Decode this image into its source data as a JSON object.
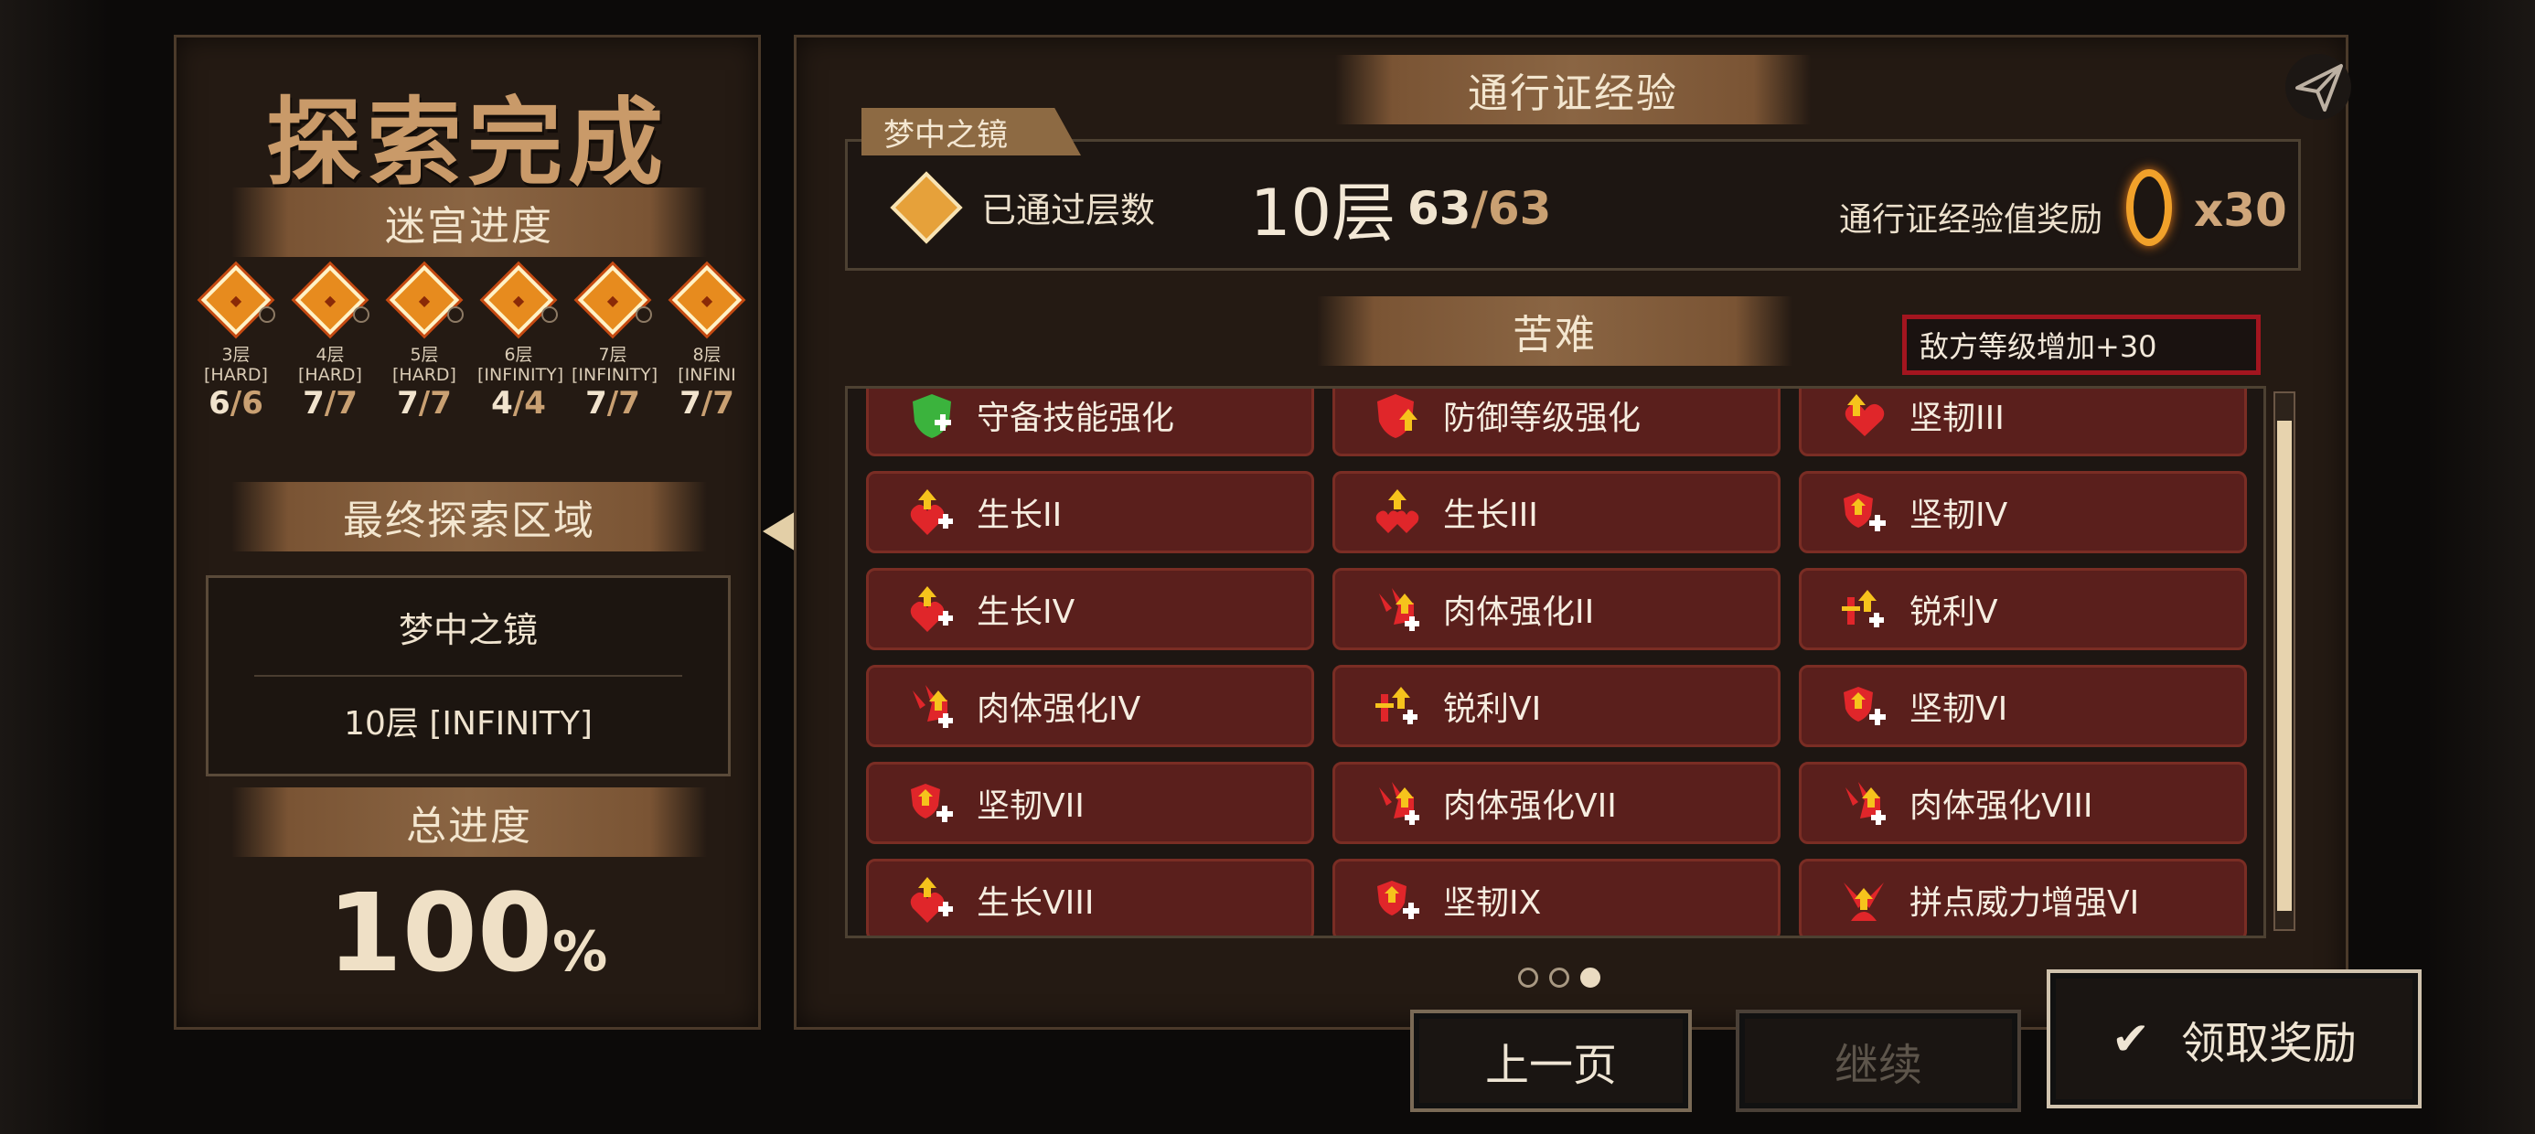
{
  "left": {
    "title": "探索完成",
    "maze_progress_title": "迷宫进度",
    "nodes": [
      {
        "layer": "3层",
        "difficulty": "[HARD]",
        "cleared": "6",
        "total": "/6"
      },
      {
        "layer": "4层",
        "difficulty": "[HARD]",
        "cleared": "7",
        "total": "/7"
      },
      {
        "layer": "5层",
        "difficulty": "[HARD]",
        "cleared": "7",
        "total": "/7"
      },
      {
        "layer": "6层",
        "difficulty": "[INFINITY]",
        "cleared": "4",
        "total": "/4"
      },
      {
        "layer": "7层",
        "difficulty": "[INFINITY]",
        "cleared": "7",
        "total": "/7"
      },
      {
        "layer": "8层",
        "difficulty": "[INFINI",
        "cleared": "7",
        "total": "/7"
      }
    ],
    "final_area_title": "最终探索区域",
    "final_area_name": "梦中之镜",
    "final_area_layer": "10层 [INFINITY]",
    "total_progress_title": "总进度",
    "total_progress_value": "100",
    "total_progress_unit": "%"
  },
  "right": {
    "pass_exp_title": "通行证经验",
    "area_tag": "梦中之镜",
    "passed_layers_label": "已通过层数",
    "passed_layers_value": "10层",
    "passed_cleared": "63",
    "passed_total": "/63",
    "reward_label": "通行证经验值奖励",
    "reward_qty": "x30",
    "hardship_title": "苦难",
    "hardship_info": "敌方等级增加+30",
    "hardships": [
      {
        "label": "守备技能强化",
        "icon": "green-shield-icon"
      },
      {
        "label": "防御等级强化",
        "icon": "red-shield-icon"
      },
      {
        "label": "坚韧III",
        "icon": "heart-up-icon"
      },
      {
        "label": "生长II",
        "icon": "heart-plus-icon"
      },
      {
        "label": "生长III",
        "icon": "double-heart-icon"
      },
      {
        "label": "坚韧IV",
        "icon": "shield-plus-icon"
      },
      {
        "label": "生长IV",
        "icon": "heart-plus-icon"
      },
      {
        "label": "肉体强化II",
        "icon": "muscle-icon"
      },
      {
        "label": "锐利V",
        "icon": "sword-up-icon"
      },
      {
        "label": "肉体强化IV",
        "icon": "muscle-icon"
      },
      {
        "label": "锐利VI",
        "icon": "sword-up-icon"
      },
      {
        "label": "坚韧VI",
        "icon": "shield-plus-icon"
      },
      {
        "label": "坚韧VII",
        "icon": "shield-plus-icon"
      },
      {
        "label": "肉体强化VII",
        "icon": "muscle-icon"
      },
      {
        "label": "肉体强化VIII",
        "icon": "muscle-icon"
      },
      {
        "label": "生长VIII",
        "icon": "heart-plus-icon"
      },
      {
        "label": "坚韧IX",
        "icon": "shield-plus-icon"
      },
      {
        "label": "拼点威力增强VI",
        "icon": "clash-power-icon"
      }
    ],
    "page_dots": {
      "count": 3,
      "active": 3
    }
  },
  "buttons": {
    "prev": "上一页",
    "continue": "继续",
    "claim": "领取奖励"
  },
  "colors": {
    "accent_orange": "#e78b1e",
    "cell_bg": "#5a1f1c",
    "info_border_red": "#a3151f",
    "denominator_tan": "#c9a072"
  }
}
